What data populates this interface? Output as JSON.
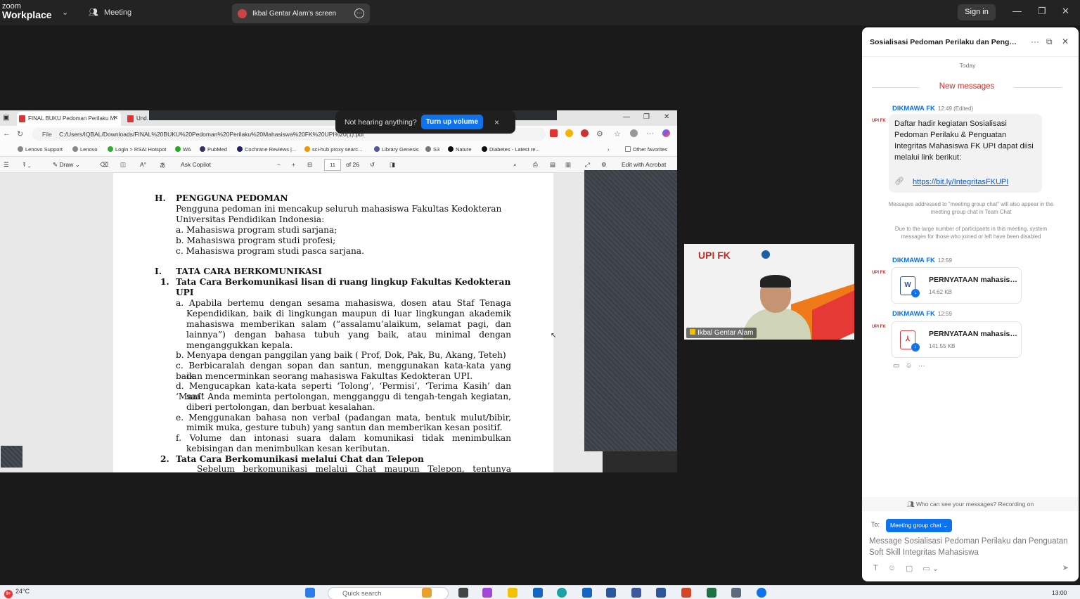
{
  "zoom": {
    "brand_top": "zoom",
    "brand_bottom": "Workplace",
    "meeting_label": "Meeting",
    "share_label": "Ikbal Gentar Alam's screen",
    "sign_in": "Sign in"
  },
  "toast": {
    "text": "Not hearing anything?",
    "button": "Turn up volume",
    "close": "×"
  },
  "browser": {
    "tab1": "FINAL BUKU Pedoman Perilaku M",
    "tab2": "Und.",
    "file_label": "File",
    "url": "C:/Users/IQBAL/Downloads/FINAL%20BUKU%20Pedoman%20Perilaku%20Mahasiswa%20FK%20UPI%20(1).pdf",
    "favorites": [
      "Lenovo Support",
      "Lenovo",
      "Login > RSAI Hotspot",
      "WA",
      "PubMed",
      "Cochrane Reviews |...",
      "sci-hub proxy searc...",
      "Library Genesis",
      "S3",
      "Nature",
      "Diabetes - Latest re..."
    ],
    "other_favorites": "Other favorites",
    "pdf_toolbar": {
      "draw": "Draw",
      "ask_copilot": "Ask Copilot",
      "page_current": "11",
      "page_total": "of 26",
      "edit": "Edit with Acrobat"
    }
  },
  "document": {
    "h_heading": "H.",
    "h_title": "PENGGUNA PEDOMAN",
    "h_para1": "Pengguna pedoman ini mencakup seluruh mahasiswa Fakultas Kedokteran",
    "h_para2": "Universitas Pendidikan Indonesia:",
    "h_items": [
      "a. Mahasiswa program studi sarjana;",
      "b. Mahasiswa program studi profesi;",
      "c. Mahasiswa program studi pasca sarjana."
    ],
    "i_heading": "I.",
    "i_title": "TATA CARA BERKOMUNIKASI",
    "s1_num": "1.",
    "s1_title1": "Tata Cara Berkomunikasi lisan di ruang lingkup Fakultas Kedokteran",
    "s1_title2": "UPI",
    "a_lines": [
      "a. Apabila bertemu dengan sesama mahasiswa, dosen atau Staf Tenaga",
      "Kependidikan, baik di lingkungan maupun di luar lingkungan akademik",
      "mahasiswa memberikan salam (“assalamu’alaikum, selamat pagi, dan",
      "lainnya”) dengan bahasa tubuh yang baik, atau minimal dengan",
      "menganggukkan kepala."
    ],
    "b_line": "b. Menyapa dengan panggilan yang baik ( Prof, Dok, Pak, Bu, Akang, Teteh)",
    "c_lines": [
      "c. Berbicaralah dengan sopan dan santun, menggunakan kata-kata yang baik",
      "dan mencerminkan seorang mahasiswa Fakultas Kedokteran UPI."
    ],
    "d_lines": [
      "d. Mengucapkan kata-kata seperti ‘Tolong’, ‘Permisi’, ‘Terima Kasih’ dan ‘Maaf’",
      "saat Anda meminta pertolongan, mengganggu di tengah-tengah kegiatan,",
      "diberi pertolongan, dan berbuat kesalahan."
    ],
    "e_lines": [
      "e. Menggunakan bahasa non verbal (padangan mata, bentuk mulut/bibir,",
      "mimik muka, gesture tubuh) yang santun dan memberikan kesan positif."
    ],
    "f_lines": [
      "f. Volume dan intonasi suara dalam komunikasi tidak menimbulkan",
      "kebisingan dan menimbulkan kesan keributan."
    ],
    "s2_num": "2.",
    "s2_title": "Tata Cara Berkomunikasi melalui Chat dan Telepon",
    "s2_cut": "Sebelum berkomunikasi melalui Chat maupun Telepon, tentunya"
  },
  "video": {
    "name": "Ikbal Gentar Alam",
    "logo": "UPI FK"
  },
  "chat": {
    "title": "Sosialisasi Pedoman Perilaku dan Penguatan Soft Skill Integritas Mahasiswa",
    "today": "Today",
    "new_messages": "New messages",
    "msg1": {
      "sender": "DIKMAWA FK",
      "time": "12:49 (Edited)",
      "text": "Daftar hadir kegiatan Sosialisasi Pedoman Perilaku & Penguatan Integritas Mahasiswa FK UPI dapat diisi melalui link berikut:",
      "link": "https://bit.ly/IntegritasFKUPI"
    },
    "sys1": "Messages addressed to \"meeting group chat\" will also appear in the meeting group chat in Team Chat",
    "sys2": "Due to the large number of participants in this meeting, system messages for those who joined or left have been disabled",
    "msg2": {
      "sender": "DIKMAWA FK",
      "time": "12:59",
      "file": "PERNYATAAN mahasiswa.docx",
      "size": "14.62 KB"
    },
    "msg3": {
      "sender": "DIKMAWA FK",
      "time": "12:59",
      "file": "PERNYATAAN mahasiswa.pdf",
      "size": "141.55 KB"
    },
    "who": "Who can see your messages? Recording on",
    "to_label": "To:",
    "to_target": "Meeting group chat ⌄",
    "placeholder": "Message Sosialisasi Pedoman Perilaku dan Penguatan Soft Skill Integritas Mahasiswa"
  },
  "taskbar": {
    "weather": "24°C",
    "badge": "9+",
    "search": "Quick search",
    "time": "13:00"
  }
}
